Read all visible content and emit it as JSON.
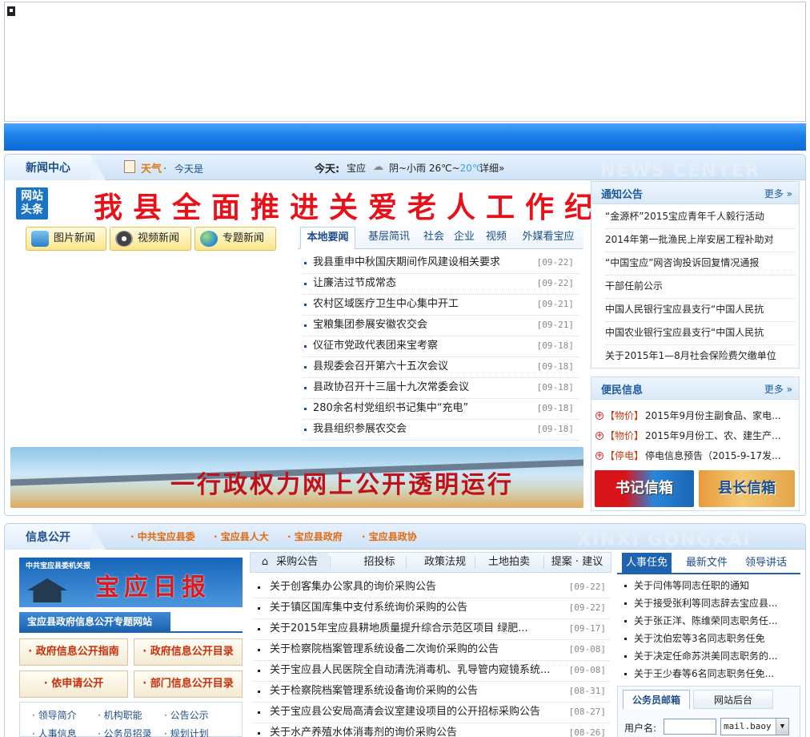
{
  "news_center": {
    "title": "新闻中心",
    "watermark": "NEWS CENTER",
    "weather": {
      "label": "天气",
      "sep": "·",
      "today_link": "今天是",
      "today_label": "今天:",
      "place": "宝应",
      "condition": "阴~小雨 26℃~",
      "low": "20℃",
      "detail": "详细»"
    },
    "headline": {
      "badge_line1": "网站",
      "badge_line2": "头条",
      "title": "我县全面推进关爱老人工作纪实"
    },
    "quick_buttons": [
      "图片新闻",
      "视频新闻",
      "专题新闻"
    ],
    "tabs": [
      "本地要闻",
      "基层简讯",
      "社会",
      "企业",
      "视频",
      "外媒看宝应"
    ],
    "items": [
      {
        "title": "我县重申中秋国庆期间作风建设相关要求",
        "date": "[09-22]"
      },
      {
        "title": "让廉洁过节成常态",
        "date": "[09-22]"
      },
      {
        "title": "农村区域医疗卫生中心集中开工",
        "date": "[09-21]"
      },
      {
        "title": "宝粮集团参展安徽农交会",
        "date": "[09-21]"
      },
      {
        "title": "仪征市党政代表团来宝考察",
        "date": "[09-18]"
      },
      {
        "title": "县规委会召开第六十五次会议",
        "date": "[09-18]"
      },
      {
        "title": "县政协召开十三届十九次常委会议",
        "date": "[09-18]"
      },
      {
        "title": "280余名村党组织书记集中“充电”",
        "date": "[09-18]"
      },
      {
        "title": "我县组织参展农交会",
        "date": "[09-18]"
      }
    ],
    "promo_banner": "一行政权力网上公开透明运行"
  },
  "notices": {
    "title": "通知公告",
    "more": "更多 »",
    "items": [
      "“金源杯”2015宝应青年千人毅行活动",
      "2014年第一批渔民上岸安居工程补助对",
      "“中国宝应”网咨询投诉回复情况通报",
      "干部任前公示",
      "中国人民银行宝应县支行“中国人民抗",
      "中国农业银行宝应县支行“中国人民抗",
      "关于2015年1—8月社会保险费欠缴单位"
    ]
  },
  "services": {
    "title": "便民信息",
    "more": "更多 »",
    "items": [
      {
        "tag": "【物价】",
        "text": "2015年9月份主副食品、家电..."
      },
      {
        "tag": "【物价】",
        "text": "2015年9月份工、农、建生产..."
      },
      {
        "tag": "【停电】",
        "text": "停电信息预告（2015-9-17发..."
      }
    ],
    "mailboxes": [
      "书记信箱",
      "县长信箱"
    ]
  },
  "info_public": {
    "title": "信息公开",
    "watermark": "XINXI GONGKAI",
    "org_links": [
      "· 中共宝应县委",
      "· 宝应县人大",
      "· 宝应县政府",
      "· 宝应县政协"
    ],
    "paper": {
      "small": "中共宝应县委机关报",
      "title": "宝应日报"
    },
    "subsite_label": "宝应县政府信息公开专题网站",
    "gov_buttons": [
      "· 政府信息公开指南",
      "· 政府信息公开目录",
      "· 依申请公开",
      "· 部门信息公开目录"
    ],
    "small_links": [
      "· 领导简介",
      "· 机构职能",
      "· 公告公示",
      "· 人事信息",
      "· 公务员招录",
      "· 规划计划"
    ],
    "proc_tabs": [
      "采购公告",
      "招投标",
      "政策法规",
      "土地拍卖",
      "提案 · 建议"
    ],
    "proc_items": [
      {
        "title": "关于创客集办公家具的询价采购公告",
        "date": "[09-22]"
      },
      {
        "title": "关于镇区国库集中支付系统询价采购的公告",
        "date": "[09-22]"
      },
      {
        "title": "关于2015年宝应县耕地质量提升综合示范区项目 绿肥...",
        "date": "[09-17]"
      },
      {
        "title": "关于检察院档案管理系统设备二次询价采购的公告",
        "date": "[09-08]"
      },
      {
        "title": "关于宝应县人民医院全自动清洗消毒机、乳导管内窥镜系统...",
        "date": "[09-08]"
      },
      {
        "title": "关于检察院档案管理系统设备询价采购的公告",
        "date": "[08-31]"
      },
      {
        "title": "关于宝应县公安局高清会议室建设项目的公开招标采购公告",
        "date": "[08-27]"
      },
      {
        "title": "关于水产养殖水体消毒剂的询价采购公告",
        "date": "[08-26]"
      }
    ],
    "person_tabs": [
      "人事任免",
      "最新文件",
      "领导讲话"
    ],
    "person_items": [
      "关于闫伟等同志任职的通知",
      "关于接受张利等同志辞去宝应县...",
      "关于张正洋、陈维荣同志职务任...",
      "关于沈伯宏等3名同志职务任免",
      "关于决定任命苏洪美同志职务的...",
      "关于王少春等6名同志职务任免..."
    ],
    "mail": {
      "tabs": [
        "公务员邮箱",
        "网站后台"
      ],
      "user_label": "用户名:",
      "domain": "mail.baoy"
    }
  },
  "colors": {
    "accent": "#1d63b0",
    "headline": "#e8111a",
    "link_orange": "#e06b10"
  }
}
